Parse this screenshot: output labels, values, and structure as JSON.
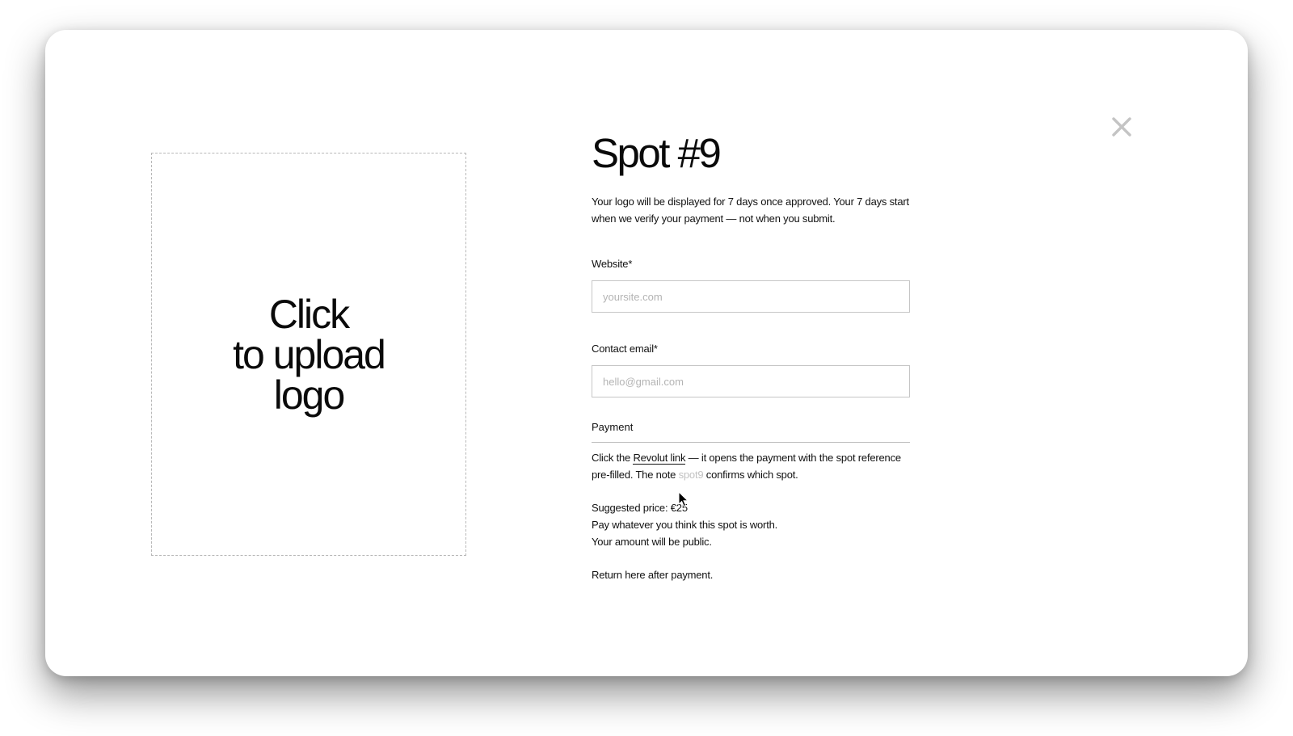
{
  "upload": {
    "line1": "Click",
    "line2": "to upload",
    "line3": "logo"
  },
  "modal": {
    "title": "Spot #9",
    "description": "Your logo will be displayed for 7 days once approved. Your 7 days start when we verify your payment — not when you submit."
  },
  "fields": {
    "website": {
      "label": "Website*",
      "placeholder": "yoursite.com",
      "value": ""
    },
    "email": {
      "label": "Contact email*",
      "placeholder": "hello@gmail.com",
      "value": ""
    }
  },
  "payment": {
    "heading": "Payment",
    "text_before_link": "Click the ",
    "link_text": "Revolut link",
    "text_after_link": " — it opens the payment with the spot reference pre-filled. The note ",
    "note_ref": "spot9",
    "text_end": " confirms which spot.",
    "price_line": "Suggested price: €25",
    "pay_line": "Pay whatever you think this spot is worth.",
    "public_line": "Your amount will be public.",
    "return_line": "Return here after payment."
  },
  "icons": {
    "close": "close-icon",
    "cursor": "mouse-pointer-icon"
  },
  "colors": {
    "text": "#111111",
    "close_icon": "#c4c4c4",
    "placeholder": "#b4b4b4",
    "note_ref": "#c2c2c2",
    "border": "#c6c6c6"
  }
}
